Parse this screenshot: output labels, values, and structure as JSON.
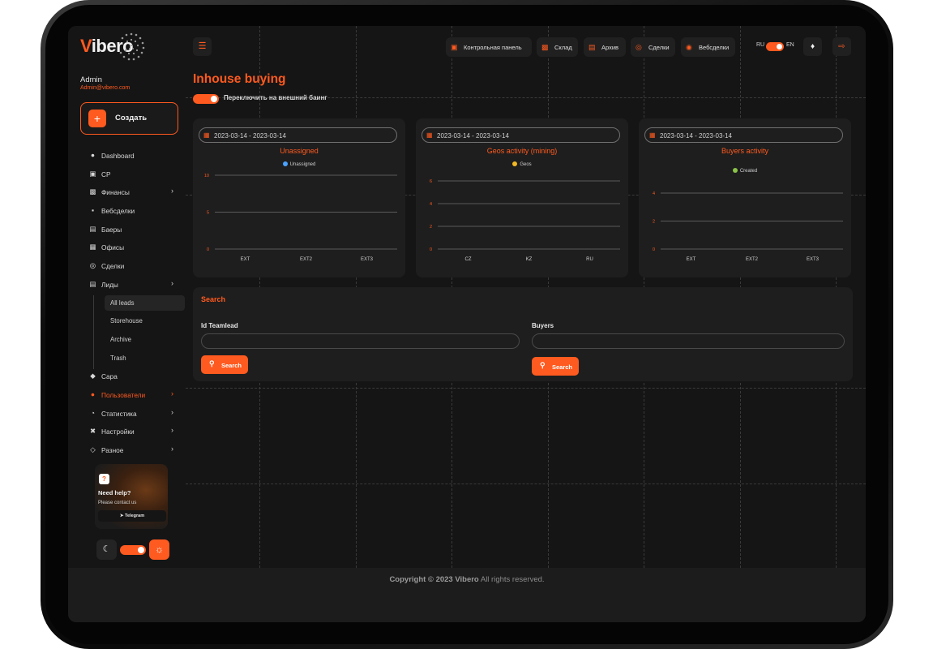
{
  "brand": {
    "logo_v": "V",
    "logo_rest": "ibero"
  },
  "user": {
    "name": "Admin",
    "email": "Admin@vibero.com"
  },
  "sidebar": {
    "create_label": "Создать",
    "items": [
      {
        "label": "Dashboard",
        "icon": "users-group-icon"
      },
      {
        "label": "CP",
        "icon": "cp-icon"
      },
      {
        "label": "Финансы",
        "icon": "finance-icon",
        "chevron": true
      },
      {
        "label": "Вебсделки",
        "icon": "websdelki-icon"
      },
      {
        "label": "Баеры",
        "icon": "buyers-icon"
      },
      {
        "label": "Офисы",
        "icon": "office-icon"
      },
      {
        "label": "Сделки",
        "icon": "deals-icon"
      },
      {
        "label": "Лиды",
        "icon": "leads-icon",
        "chevron": true
      }
    ],
    "sub_items": [
      "All leads",
      "Storehouse",
      "Archive",
      "Trash"
    ],
    "items_after": [
      {
        "label": "Capa",
        "icon": "capa-icon"
      },
      {
        "label": "Пользователи",
        "icon": "users-icon",
        "chevron": true,
        "active": true
      },
      {
        "label": "Статистика",
        "icon": "stats-icon",
        "chevron": true
      },
      {
        "label": "Настройки",
        "icon": "settings-icon",
        "chevron": true
      },
      {
        "label": "Разное",
        "icon": "misc-icon",
        "chevron": true
      }
    ],
    "help": {
      "title": "Need help?",
      "subtitle": "Please contact us",
      "button": "Telegram"
    }
  },
  "topbar": {
    "buttons": [
      {
        "label": "Контрольная панель"
      },
      {
        "label": "Склад"
      },
      {
        "label": "Архив"
      },
      {
        "label": "Сделки"
      },
      {
        "label": "Вебсделки"
      }
    ],
    "lang_left": "RU",
    "lang_right": "EN"
  },
  "page": {
    "title": "Inhouse buying",
    "switch_label": "Переключить на внешний баинг"
  },
  "colors": {
    "accent": "#ff5a1f",
    "bg": "#151515",
    "card": "#1e1e1e"
  },
  "chart_data": [
    {
      "type": "bar",
      "title": "Unassigned",
      "date_range": "2023-03-14 - 2023-03-14",
      "categories": [
        "EXT",
        "EXT2",
        "EXT3"
      ],
      "series": [
        {
          "name": "Unassigned",
          "values": [
            0,
            0,
            0
          ],
          "color": "#4aa3ff"
        }
      ],
      "yticks": [
        "0",
        "5",
        "10"
      ],
      "ylim": [
        0,
        10
      ]
    },
    {
      "type": "bar",
      "title": "Geos activity (mining)",
      "date_range": "2023-03-14 - 2023-03-14",
      "categories": [
        "CZ",
        "KZ",
        "RU"
      ],
      "series": [
        {
          "name": "Geos",
          "values": [
            0,
            0,
            0
          ],
          "color": "#f2b824"
        }
      ],
      "yticks": [
        "0",
        "2",
        "4",
        "6"
      ],
      "ylim": [
        0,
        6
      ]
    },
    {
      "type": "bar",
      "title": "Buyers activity",
      "date_range": "2023-03-14 - 2023-03-14",
      "categories": [
        "EXT",
        "EXT2",
        "EXT3"
      ],
      "series": [
        {
          "name": "Created",
          "values": [
            0,
            0,
            0
          ],
          "color": "#8bc34a"
        }
      ],
      "yticks": [
        "0",
        "2",
        "4"
      ],
      "ylim": [
        0,
        4
      ]
    }
  ],
  "search": {
    "title": "Search",
    "field1_label": "Id Teamlead",
    "field2_label": "Buyers",
    "button_label": "Search"
  },
  "footer": {
    "bold": "Copyright © 2023 Vibero",
    "rest": " All rights reserved."
  }
}
